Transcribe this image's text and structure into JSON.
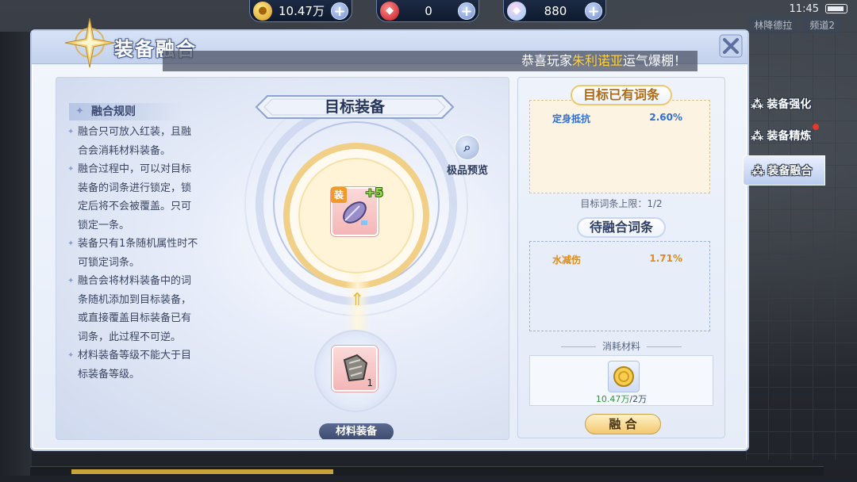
{
  "resources": [
    {
      "icon": "gold-coin-icon",
      "value": "10.47万"
    },
    {
      "icon": "red-gem-icon",
      "value": "0"
    },
    {
      "icon": "diamond-icon",
      "value": "880"
    }
  ],
  "status": {
    "time": "11:45"
  },
  "background_tabs": [
    "林降德拉",
    "频道2"
  ],
  "window": {
    "title": "装备融合",
    "ticker_prefix": "恭喜玩家",
    "ticker_name": "朱利诺亚",
    "ticker_suffix": "运气爆棚！"
  },
  "rules": {
    "title": "融合规则",
    "items": [
      "融合只可放入红装，且融合会消耗材料装备。",
      "融合过程中，可以对目标装备的词条进行锁定，锁定后将不会被覆盖。只可锁定一条。",
      "装备只有1条随机属性时不可锁定词条。",
      "融合会将材料装备中的词条随机添加到目标装备，或直接覆盖目标装备已有词条，此过程不可逆。",
      "材料装备等级不能大于目标装备等级。"
    ]
  },
  "target": {
    "banner": "目标装备",
    "tag": "装",
    "refine": "+5"
  },
  "preview_label": "极品预览",
  "material": {
    "label": "材料装备",
    "qty": "1"
  },
  "side": {
    "existing_title": "目标已有词条",
    "existing_rows": [
      {
        "name": "定身抵抗",
        "value": "2.60%"
      }
    ],
    "limit_text": "目标词条上限：1/2",
    "pending_title": "待融合词条",
    "pending_rows": [
      {
        "name": "水减伤",
        "value": "1.71%"
      }
    ],
    "consume_label": "消耗材料",
    "cost_have": "10.47万",
    "cost_need": "/2万",
    "fuse_button": "融 合"
  },
  "nav": [
    {
      "label": "装备强化",
      "active": false
    },
    {
      "label": "装备精炼",
      "active": false
    },
    {
      "label": "装备融合",
      "active": true
    }
  ],
  "colors": {
    "accent_gold": "#ffd03a",
    "pending_orange": "#e28a17",
    "existing_blue": "#2f6fd6",
    "cost_green": "#2d9b3c"
  }
}
